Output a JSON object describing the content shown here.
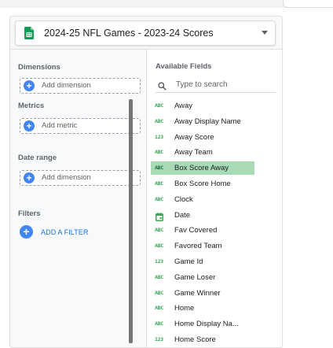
{
  "data_source": {
    "name": "2024-25 NFL Games - 2023-24 Scores",
    "icon": "google-sheets-icon"
  },
  "setup": {
    "dimensions": {
      "label": "Dimensions",
      "add_label": "Add dimension"
    },
    "metrics": {
      "label": "Metrics",
      "add_label": "Add metric"
    },
    "date_range": {
      "label": "Date range",
      "add_label": "Add dimension"
    },
    "filters": {
      "label": "Filters",
      "add_label": "ADD A FILTER"
    }
  },
  "available_fields": {
    "label": "Available Fields",
    "search_placeholder": "Type to search",
    "type_icons": {
      "text": "ABC",
      "number": "123"
    },
    "items": [
      {
        "name": "Away",
        "type": "text"
      },
      {
        "name": "Away Display Name",
        "type": "text"
      },
      {
        "name": "Away Score",
        "type": "number"
      },
      {
        "name": "Away Team",
        "type": "text"
      },
      {
        "name": "Box Score Away",
        "type": "text",
        "selected": true
      },
      {
        "name": "Box Score Home",
        "type": "text"
      },
      {
        "name": "Clock",
        "type": "text"
      },
      {
        "name": "Date",
        "type": "date"
      },
      {
        "name": "Fav Covered",
        "type": "text"
      },
      {
        "name": "Favored Team",
        "type": "text"
      },
      {
        "name": "Game Id",
        "type": "number"
      },
      {
        "name": "Game Loser",
        "type": "text"
      },
      {
        "name": "Game Winner",
        "type": "text"
      },
      {
        "name": "Home",
        "type": "text"
      },
      {
        "name": "Home Display Na...",
        "type": "text"
      },
      {
        "name": "Home Score",
        "type": "number"
      }
    ]
  },
  "colors": {
    "accent": "#4285f4",
    "field_type": "#34a853",
    "selected_row": "#a8dab5",
    "sheets_green": "#0f9d58"
  }
}
